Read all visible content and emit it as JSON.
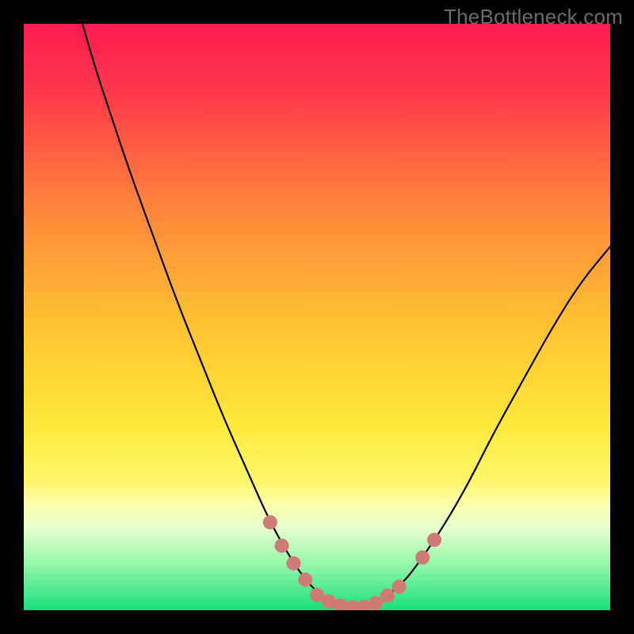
{
  "watermark": "TheBottleneck.com",
  "gradient": {
    "stops": [
      {
        "offset": "0%",
        "color": "#ff1a52"
      },
      {
        "offset": "12%",
        "color": "#ff3a4a"
      },
      {
        "offset": "30%",
        "color": "#ff803c"
      },
      {
        "offset": "50%",
        "color": "#ffbf32"
      },
      {
        "offset": "68%",
        "color": "#ffe83a"
      },
      {
        "offset": "78%",
        "color": "#fff66a"
      },
      {
        "offset": "82%",
        "color": "#fbffad"
      },
      {
        "offset": "86%",
        "color": "#e7ffcc"
      },
      {
        "offset": "92%",
        "color": "#97f7a8"
      },
      {
        "offset": "100%",
        "color": "#18e07a"
      }
    ]
  },
  "curve": {
    "stroke": "#000000",
    "stroke_width": 2.2,
    "marker_fill": "#d17b78",
    "marker_radius": 9
  },
  "chart_data": {
    "type": "line",
    "title": "",
    "xlabel": "",
    "ylabel": "",
    "xlim": [
      0,
      100
    ],
    "ylim": [
      0,
      100
    ],
    "series": [
      {
        "name": "curve",
        "x": [
          10,
          12,
          15,
          18,
          22,
          26,
          30,
          34,
          38,
          42,
          46,
          49,
          52,
          54,
          56,
          58,
          60,
          62,
          65,
          68,
          72,
          76,
          80,
          85,
          90,
          95,
          100
        ],
        "y": [
          100,
          93,
          84,
          75,
          64,
          53,
          43,
          33,
          24,
          15,
          8,
          4,
          1.5,
          0.8,
          0.5,
          0.6,
          1.2,
          2.5,
          5,
          9,
          15,
          22,
          30,
          39,
          48,
          56,
          62
        ]
      }
    ],
    "markers": {
      "name": "highlighted-points",
      "x": [
        42,
        44,
        46,
        48,
        50,
        52,
        54,
        56,
        58,
        60,
        62,
        64,
        68,
        70
      ],
      "y": [
        15,
        11,
        8,
        5.2,
        2.6,
        1.5,
        0.8,
        0.5,
        0.6,
        1.2,
        2.5,
        4,
        9,
        12
      ]
    }
  }
}
